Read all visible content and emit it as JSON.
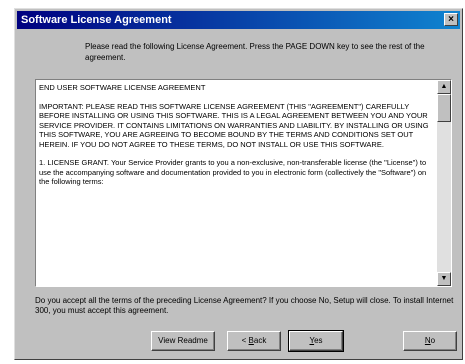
{
  "window": {
    "title": "Software License Agreement",
    "close_glyph": "×"
  },
  "prompt": "Please read the following License Agreement. Press the PAGE DOWN key to see the rest of the agreement.",
  "license": {
    "heading": "END USER SOFTWARE LICENSE AGREEMENT",
    "paragraphs": [
      "IMPORTANT: PLEASE READ THIS SOFTWARE LICENSE AGREEMENT (THIS \"AGREEMENT\") CAREFULLY BEFORE INSTALLING OR USING THIS SOFTWARE. THIS IS A LEGAL AGREEMENT BETWEEN YOU AND YOUR SERVICE PROVIDER. IT CONTAINS LIMITATIONS ON WARRANTIES AND LIABILITY. BY INSTALLING OR USING THIS SOFTWARE, YOU ARE AGREEING TO BECOME BOUND BY THE TERMS AND CONDITIONS SET OUT HEREIN. IF YOU DO NOT AGREE TO THESE TERMS, DO NOT INSTALL OR USE THIS SOFTWARE.",
      "1. LICENSE GRANT. Your Service Provider grants to you a non-exclusive, non-transferable license (the \"License\") to use the accompanying software and documentation provided to you in electronic form (collectively the \"Software\") on the following terms:"
    ]
  },
  "question": "Do you accept all the terms of the preceding License Agreement? If you choose No, Setup will close. To install Internet 300, you must accept this agreement.",
  "buttons": {
    "readme": "View Readme",
    "back_prefix": "< ",
    "back_hot": "B",
    "back_rest": "ack",
    "yes_hot": "Y",
    "yes_rest": "es",
    "no_hot": "N",
    "no_rest": "o"
  },
  "icons": {
    "scroll_up": "up-arrow-icon",
    "scroll_down": "down-arrow-icon"
  }
}
